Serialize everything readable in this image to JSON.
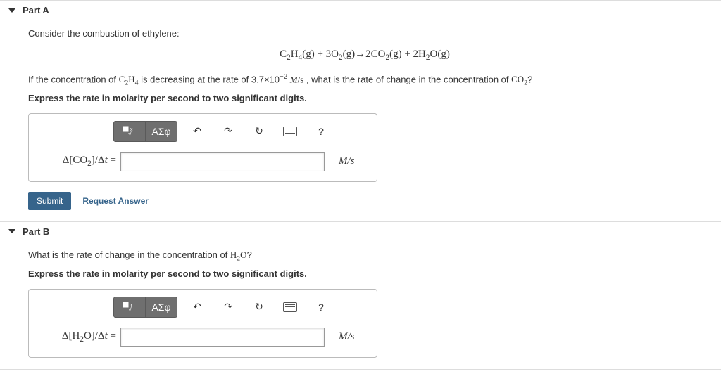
{
  "partA": {
    "title": "Part A",
    "intro": "Consider the combustion of ethylene:",
    "equation_html": "C<span class='sub2'>2</span>H<span class='sub2'>4</span>(g) + 3O<span class='sub2'>2</span>(g)→2CO<span class='sub2'>2</span>(g) + 2H<span class='sub2'>2</span>O(g)",
    "question_html": "If the concentration of <span class='serif'>C<span class=\"sub2\">2</span>H<span class=\"sub2\">4</span></span> is decreasing at the rate of 3.7×10<span class='sup2'>−2</span> <span class='serif'><i>M</i>/s</span> , what is the rate of change in the concentration of <span class='serif'>CO<span class=\"sub2\">2</span></span>?",
    "instruction": "Express the rate in molarity per second to two significant digits.",
    "answer_label_html": "Δ[CO<span class='sub2'>2</span>]/Δ<i>t</i> =",
    "unit_html": "<i>M</i>/s",
    "value": ""
  },
  "toolbar": {
    "templates_label": "■√x",
    "greek_label": "ΑΣφ",
    "help_label": "?"
  },
  "actions": {
    "submit": "Submit",
    "request": "Request Answer"
  },
  "partB": {
    "title": "Part B",
    "question_html": "What is the rate of change in the concentration of <span class='serif'>H<span class=\"sub2\">2</span>O</span>?",
    "instruction": "Express the rate in molarity per second to two significant digits.",
    "answer_label_html": "Δ[H<span class='sub2'>2</span>O]/Δ<i>t</i> =",
    "unit_html": "<i>M</i>/s",
    "value": ""
  }
}
